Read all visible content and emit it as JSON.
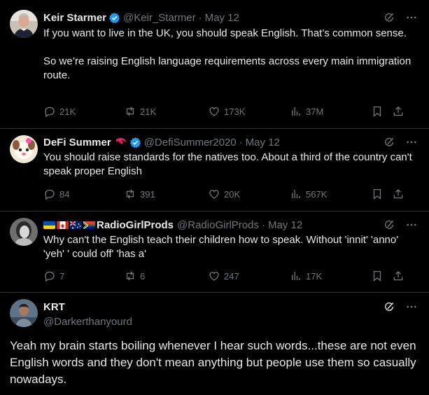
{
  "tweets": [
    {
      "name": "Keir Starmer",
      "handle": "@Keir_Starmer",
      "date": "May 12",
      "text_p1": "If you want to live in the UK, you should speak English. That’s common sense.",
      "text_p2": "So we’re raising English language requirements across every main immigration route.",
      "replies": "21K",
      "reposts": "21K",
      "likes": "173K",
      "views": "37M"
    },
    {
      "name": "DeFi Summer",
      "handle": "@DefiSummer2020",
      "date": "May 12",
      "text": "You should raise standards for the natives too. About a third of the country can't speak proper English",
      "replies": "84",
      "reposts": "391",
      "likes": "20K",
      "views": "567K"
    },
    {
      "name": "RadioGirlProds",
      "handle": "@RadioGirlProds",
      "date": "May 12",
      "text": "Why can't the English teach their children how to speak. Without 'innit' 'anno' 'yeh' ' could off' 'has a'",
      "replies": "7",
      "reposts": "6",
      "likes": "247",
      "views": "17K"
    },
    {
      "name": "KRT",
      "handle": "@Darkerthanyourd",
      "text": "Yeah my brain starts boiling whenever I hear such words...these are not even English words and they don't mean anything but people use them so casually nowadays."
    }
  ],
  "icons": {
    "reply": "reply-icon",
    "repost": "repost-icon",
    "like": "like-icon",
    "views": "views-icon",
    "bookmark": "bookmark-icon",
    "share": "share-icon",
    "grok": "grok-icon",
    "more": "more-icon"
  },
  "colors": {
    "background": "#000000",
    "text": "#e7e9ea",
    "muted": "#71767b",
    "divider": "#2f3336",
    "verified": "#1d9bf0"
  }
}
